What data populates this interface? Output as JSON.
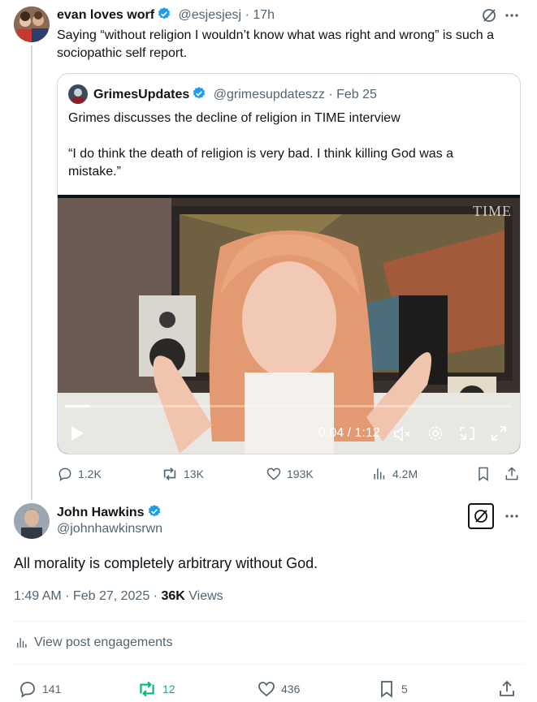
{
  "parent_tweet": {
    "name": "evan loves worf",
    "handle": "@esjesjesj",
    "time": "· 17h",
    "text": "Saying “without religion I wouldn’t know what was right and wrong” is such a sociopathic self report.",
    "quote": {
      "name": "GrimesUpdates",
      "handle": "@grimesupdateszz",
      "time": "· Feb 25",
      "line1": "Grimes discusses the decline of religion in TIME interview",
      "line2": "“I do think the death of religion is very bad. I think killing God was a mistake.”",
      "video": {
        "watermark": "TIME",
        "time_display": "0:04 / 1:12",
        "progress_fraction": 0.056
      }
    },
    "actions": {
      "replies": "1.2K",
      "reposts": "13K",
      "likes": "193K",
      "views": "4.2M"
    }
  },
  "main_tweet": {
    "name": "John Hawkins",
    "handle": "@johnhawkinsrwn",
    "text": "All morality is completely arbitrary without God.",
    "timestamp": "1:49 AM · Feb 27, 2025 ·",
    "views_count": "36K",
    "views_label": "Views",
    "engagements_label": "View post engagements",
    "actions": {
      "replies": "141",
      "reposts": "12",
      "likes": "436",
      "bookmarks": "5"
    }
  },
  "colors": {
    "text": "#0f1419",
    "muted": "#536471",
    "verified": "#1d9bf0",
    "repost_active": "#00ba7c",
    "border": "#cfd9de"
  }
}
